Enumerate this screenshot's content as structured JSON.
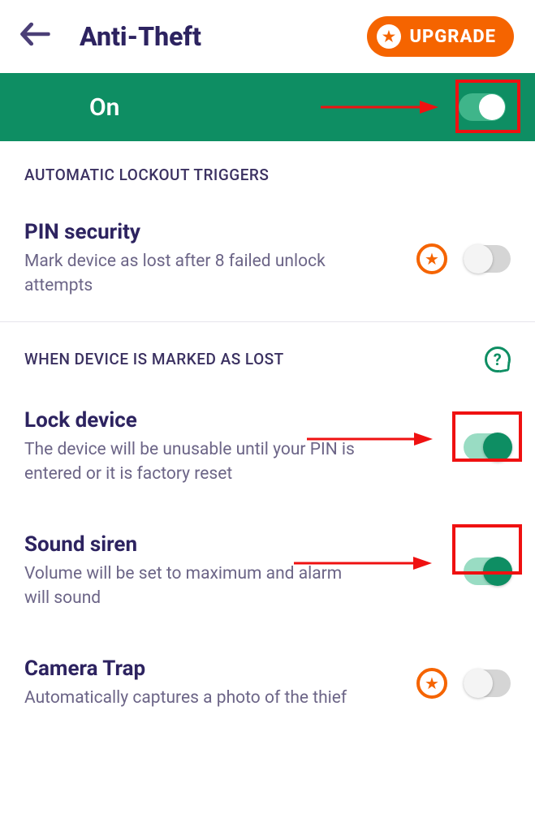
{
  "header": {
    "title": "Anti-Theft",
    "upgrade_label": "UPGRADE"
  },
  "master": {
    "label": "On",
    "enabled": true
  },
  "sections": {
    "triggers": {
      "header": "AUTOMATIC LOCKOUT TRIGGERS",
      "pin_security": {
        "title": "PIN security",
        "desc": "Mark device as lost after 8 failed unlock attempts",
        "premium": true,
        "enabled": false
      }
    },
    "lost": {
      "header": "WHEN DEVICE IS MARKED AS LOST",
      "lock_device": {
        "title": "Lock device",
        "desc": "The device will be unusable until your PIN is entered or it is factory reset",
        "enabled": true
      },
      "sound_siren": {
        "title": "Sound siren",
        "desc": "Volume will be set to maximum and alarm will sound",
        "enabled": true
      },
      "camera_trap": {
        "title": "Camera Trap",
        "desc": "Automatically captures a photo of the thief",
        "premium": true,
        "enabled": false
      }
    }
  },
  "annotations": {
    "highlight_color": "#ef1111"
  }
}
